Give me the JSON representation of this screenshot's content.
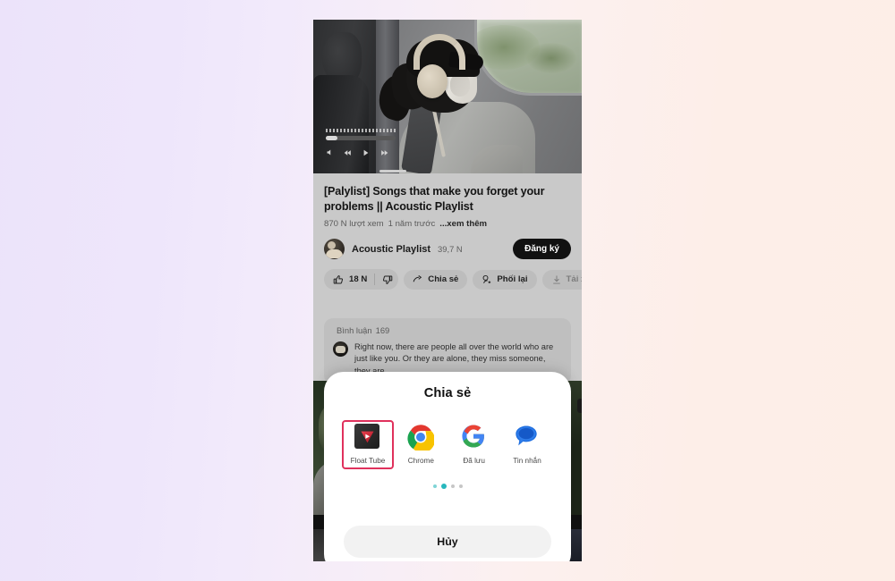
{
  "background": {
    "gradient_left": "#ece3fa",
    "gradient_right": "#fdeee7"
  },
  "phone": {
    "video": {
      "title": "[Palylist] Songs that make you forget your problems || Acoustic Playlist",
      "views": "870 N lượt xem",
      "age": "1 năm trước",
      "more_label": "...xem thêm",
      "player_controls": [
        "volume-icon",
        "rewind-icon",
        "play-icon",
        "fast-forward-icon"
      ]
    },
    "channel": {
      "name": "Acoustic Playlist",
      "subscribers": "39,7 N",
      "subscribe_label": "Đăng ký",
      "avatar_name": "channel-avatar"
    },
    "actions": [
      {
        "icon": "thumbs-up-icon",
        "label": "18 N",
        "dim": false
      },
      {
        "icon": "thumbs-down-icon",
        "label": "",
        "dim": false
      },
      {
        "icon": "share-arrow-icon",
        "label": "Chia sẻ",
        "dim": false
      },
      {
        "icon": "remix-icon",
        "label": "Phối lại",
        "dim": false
      },
      {
        "icon": "download-icon",
        "label": "Tải xuống",
        "dim": true
      }
    ],
    "comments": {
      "heading": "Bình luận",
      "count": "169",
      "top_comment": "Right now, there are people all over the world who are just like you. Or they are alone, they miss someone, they are ..."
    }
  },
  "share_sheet": {
    "title": "Chia sẻ",
    "apps": [
      {
        "label": "Float Tube",
        "icon": "float-tube-icon",
        "selected": true
      },
      {
        "label": "Chrome",
        "icon": "chrome-icon",
        "selected": false
      },
      {
        "label": "Đã lưu",
        "icon": "google-saved-icon",
        "selected": false
      },
      {
        "label": "Tin nhắn",
        "icon": "messages-icon",
        "selected": false
      }
    ],
    "pagination": {
      "total": 4,
      "active_index": 1
    },
    "cancel_label": "Hủy",
    "highlight_color": "#e0315c",
    "active_dot_color": "#27b7bd"
  }
}
